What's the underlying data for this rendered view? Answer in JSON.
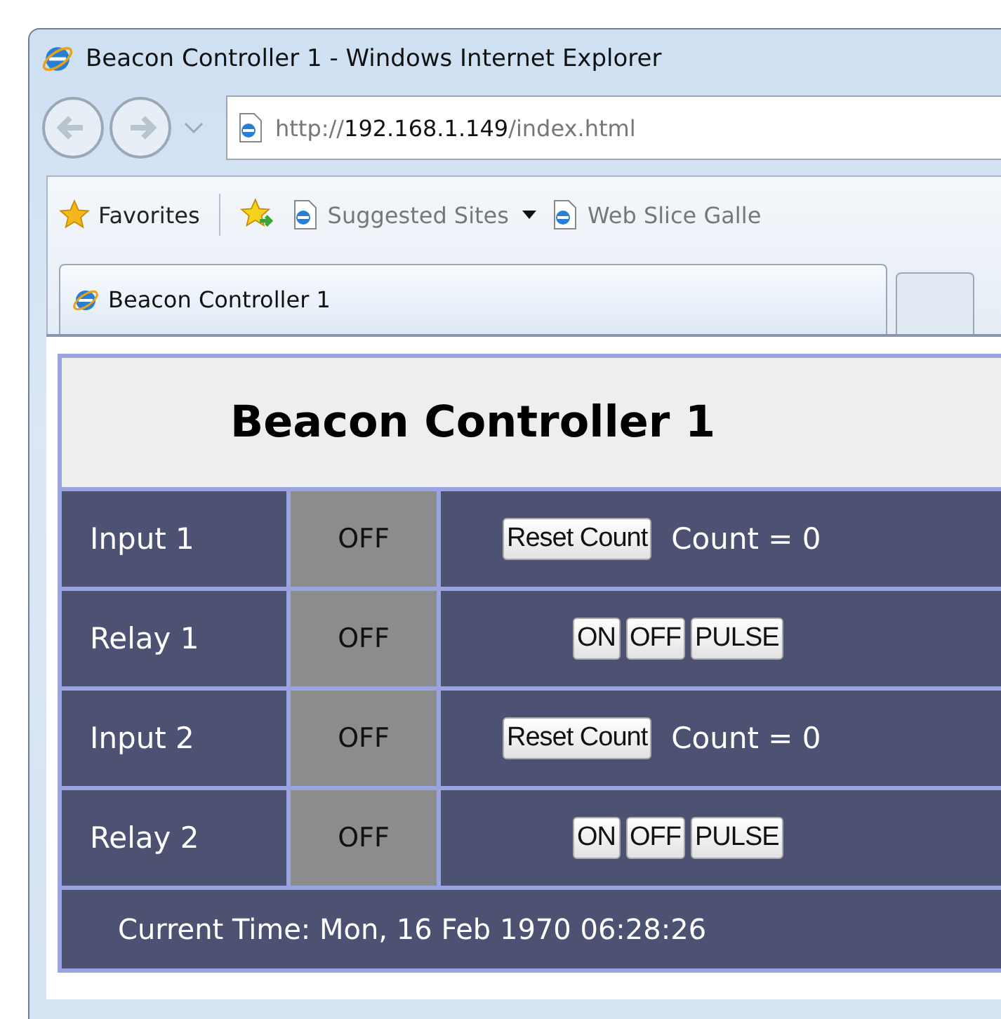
{
  "window": {
    "title": "Beacon Controller 1 - Windows Internet Explorer"
  },
  "address": {
    "prefix": "http://",
    "host": "192.168.1.149",
    "path": "/index.html"
  },
  "favorites_bar": {
    "favorites": "Favorites",
    "links": [
      {
        "label": "Suggested Sites",
        "dropdown": true
      },
      {
        "label": "Web Slice Galle",
        "dropdown": false
      }
    ]
  },
  "tabs": [
    {
      "label": "Beacon Controller 1",
      "selected": true
    },
    {
      "selected": false
    }
  ],
  "page": {
    "heading": "Beacon Controller 1",
    "rows": [
      {
        "kind": "input",
        "name": "Input 1",
        "status": "OFF",
        "button": "Reset Count",
        "count": "Count = 0"
      },
      {
        "kind": "relay",
        "name": "Relay 1",
        "status": "OFF",
        "buttons": [
          "ON",
          "OFF",
          "PULSE"
        ]
      },
      {
        "kind": "input",
        "name": "Input 2",
        "status": "OFF",
        "button": "Reset Count",
        "count": "Count = 0"
      },
      {
        "kind": "relay",
        "name": "Relay 2",
        "status": "OFF",
        "buttons": [
          "ON",
          "OFF",
          "PULSE"
        ]
      }
    ],
    "footer": "Current Time: Mon, 16 Feb 1970 06:28:26"
  }
}
